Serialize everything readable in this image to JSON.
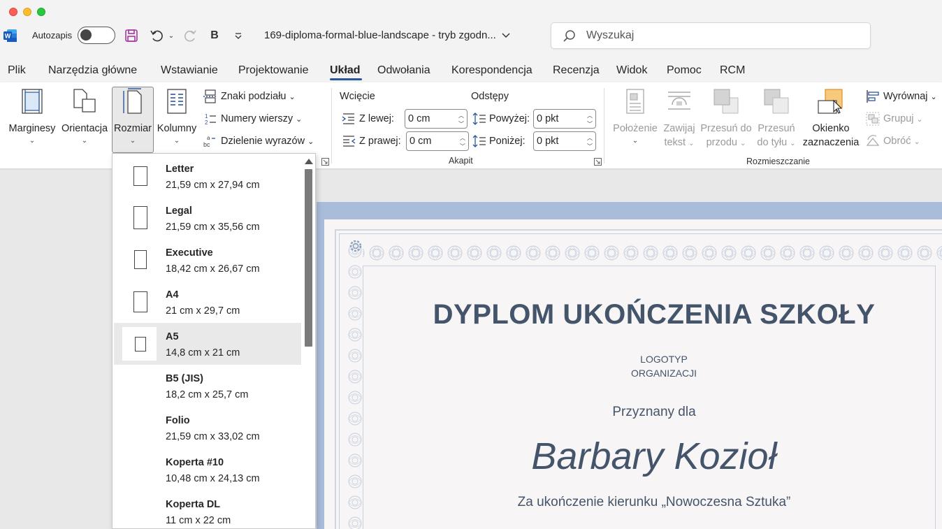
{
  "window": {
    "autosave_label": "Autozapis",
    "document_title": "169-diploma-formal-blue-landscape  -  tryb zgodn...",
    "search_placeholder": "Wyszukaj"
  },
  "tabs": [
    {
      "label": "Plik"
    },
    {
      "label": "Narzędzia główne"
    },
    {
      "label": "Wstawianie"
    },
    {
      "label": "Projektowanie"
    },
    {
      "label": "Układ"
    },
    {
      "label": "Odwołania"
    },
    {
      "label": "Korespondencja"
    },
    {
      "label": "Recenzja"
    },
    {
      "label": "Widok"
    },
    {
      "label": "Pomoc"
    },
    {
      "label": "RCM"
    }
  ],
  "active_tab": "Układ",
  "ribbon": {
    "page_setup": {
      "margins": "Marginesy",
      "orientation": "Orientacja",
      "size": "Rozmiar",
      "columns": "Kolumny",
      "breaks": "Znaki podziału",
      "line_numbers": "Numery wierszy",
      "hyphenation": "Dzielenie wyrazów"
    },
    "paragraph": {
      "indent_header": "Wcięcie",
      "spacing_header": "Odstępy",
      "left_label": "Z lewej:",
      "left_value": "0  cm",
      "right_label": "Z prawej:",
      "right_value": "0  cm",
      "before_label": "Powyżej:",
      "before_value": "0 pkt",
      "after_label": "Poniżej:",
      "after_value": "0 pkt",
      "group_label": "Akapit"
    },
    "arrange": {
      "position_1": "Położenie",
      "wrap_1": "Zawijaj",
      "wrap_2": "tekst",
      "forward_1": "Przesuń do",
      "forward_2": "przodu",
      "backward_1": "Przesuń",
      "backward_2": "do tyłu",
      "selection_1": "Okienko",
      "selection_2": "zaznaczenia",
      "align": "Wyrównaj",
      "group": "Grupuj",
      "rotate": "Obróć",
      "group_label": "Rozmieszczanie"
    }
  },
  "size_menu": {
    "items": [
      {
        "name": "Letter",
        "dims": "21,59  cm x 27,94  cm"
      },
      {
        "name": "Legal",
        "dims": "21,59  cm x 35,56  cm"
      },
      {
        "name": "Executive",
        "dims": "18,42  cm x 26,67  cm"
      },
      {
        "name": "A4",
        "dims": "21  cm x 29,7  cm"
      },
      {
        "name": "A5",
        "dims": "14,8  cm x 21  cm"
      },
      {
        "name": "B5 (JIS)",
        "dims": "18,2  cm x 25,7  cm"
      },
      {
        "name": "Folio",
        "dims": "21,59  cm x 33,02  cm"
      },
      {
        "name": "Koperta #10",
        "dims": "10,48  cm x 24,13  cm"
      },
      {
        "name": "Koperta DL",
        "dims": "11  cm x 22  cm"
      }
    ],
    "hovered": "A5"
  },
  "diploma": {
    "title": "DYPLOM UKOŃCZENIA SZKOŁY",
    "logo_line1": "LOGOTYP",
    "logo_line2": "ORGANIZACJI",
    "awarded_to": "Przyznany dla",
    "recipient": "Barbary Kozioł",
    "course": "Za ukończenie kierunku „Nowoczesna Sztuka”"
  },
  "colors": {
    "accent": "#2b579a",
    "diploma_text": "#44546a",
    "page_border": "#a9bcd9"
  }
}
